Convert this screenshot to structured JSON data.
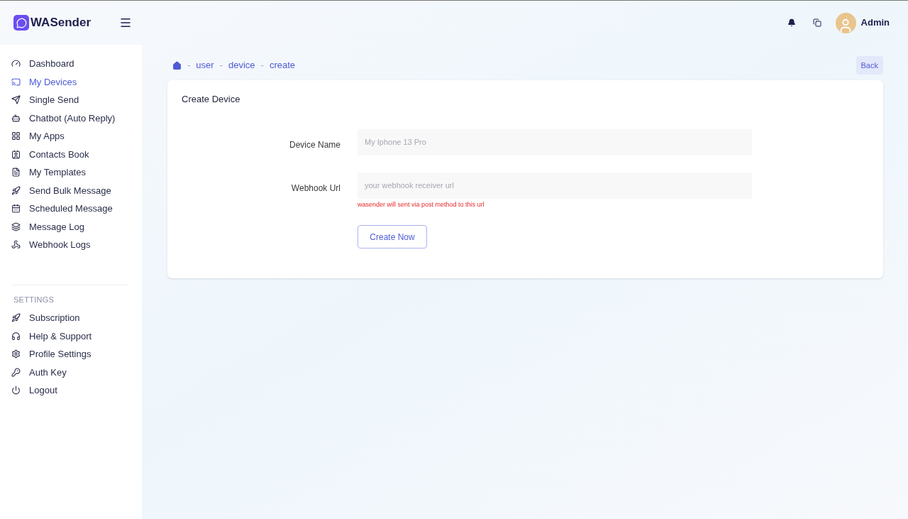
{
  "brand": {
    "name": "WASender"
  },
  "header": {
    "user": "Admin"
  },
  "sidebar": {
    "items": [
      {
        "label": "Dashboard",
        "selected": false
      },
      {
        "label": "My Devices",
        "selected": true
      },
      {
        "label": "Single Send",
        "selected": false
      },
      {
        "label": "Chatbot (Auto Reply)",
        "selected": false
      },
      {
        "label": "My Apps",
        "selected": false
      },
      {
        "label": "Contacts Book",
        "selected": false
      },
      {
        "label": "My Templates",
        "selected": false
      },
      {
        "label": "Send Bulk Message",
        "selected": false
      },
      {
        "label": "Scheduled Message",
        "selected": false
      },
      {
        "label": "Message Log",
        "selected": false
      },
      {
        "label": "Webhook Logs",
        "selected": false
      }
    ],
    "settings_heading": "SETTINGS",
    "settings_items": [
      {
        "label": "Subscription",
        "selected": false
      },
      {
        "label": "Help & Support",
        "selected": false
      },
      {
        "label": "Profile Settings",
        "selected": false
      },
      {
        "label": "Auth Key",
        "selected": false
      },
      {
        "label": "Logout",
        "selected": false
      }
    ]
  },
  "breadcrumb": [
    {
      "separator": "-",
      "label": "user"
    },
    {
      "separator": "-",
      "label": "device"
    },
    {
      "separator": "-",
      "label": "create"
    }
  ],
  "back_button": "Back",
  "card": {
    "title": "Create Device",
    "fields": [
      {
        "label": "Device Name",
        "placeholder": "My Iphone 13 Pro"
      },
      {
        "label": "Webhook Url",
        "placeholder": "your webhook receiver url",
        "hint": "wasender will sent via post method to this url"
      }
    ],
    "submit": "Create Now"
  }
}
